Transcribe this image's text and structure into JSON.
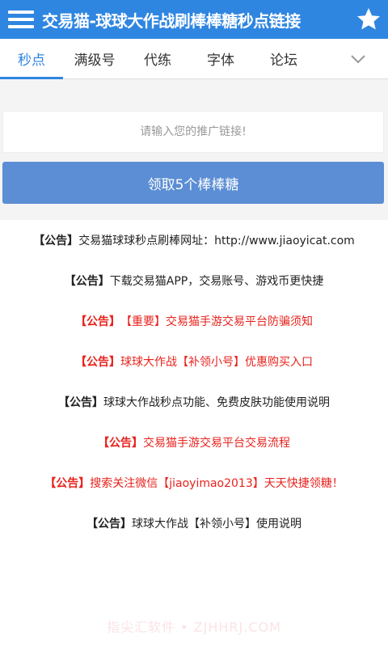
{
  "header": {
    "menu_icon": "menu-icon",
    "title": "交易猫-球球大作战刷棒棒糖秒点链接",
    "star_icon": "star-icon",
    "bg_color": "#2f86e1"
  },
  "tabs": [
    {
      "label": "秒点",
      "active": true
    },
    {
      "label": "满级号",
      "active": false
    },
    {
      "label": "代练",
      "active": false
    },
    {
      "label": "字体",
      "active": false
    },
    {
      "label": "论坛",
      "active": false
    }
  ],
  "tabs_more_icon": "chevron-down-icon",
  "form": {
    "placeholder": "请输入您的推广链接!",
    "value": "",
    "submit_label": "领取5个棒棒糖"
  },
  "notices": [
    {
      "tag": "【公告】",
      "text": "交易猫球球秒点刷棒网址：http://www.jiaoyicat.com",
      "color": "black"
    },
    {
      "tag": "【公告】",
      "text": "下载交易猫APP，交易账号、游戏币更快捷",
      "color": "black"
    },
    {
      "tag": "【公告】",
      "text": "【重要】交易猫手游交易平台防骗须知",
      "color": "red"
    },
    {
      "tag": "【公告】",
      "text": "球球大作战【补领小号】优惠购买入口",
      "color": "red"
    },
    {
      "tag": "【公告】",
      "text": "球球大作战秒点功能、免费皮肤功能使用说明",
      "color": "black"
    },
    {
      "tag": "【公告】",
      "text": "交易猫手游交易平台交易流程",
      "color": "red"
    },
    {
      "tag": "【公告】",
      "text": "搜索关注微信【jiaoyimao2013】天天快捷领糖！",
      "color": "red"
    },
    {
      "tag": "【公告】",
      "text": "球球大作战【补领小号】使用说明",
      "color": "black"
    }
  ],
  "watermark": "指尖汇软件 • ZJHHRJ.COM"
}
